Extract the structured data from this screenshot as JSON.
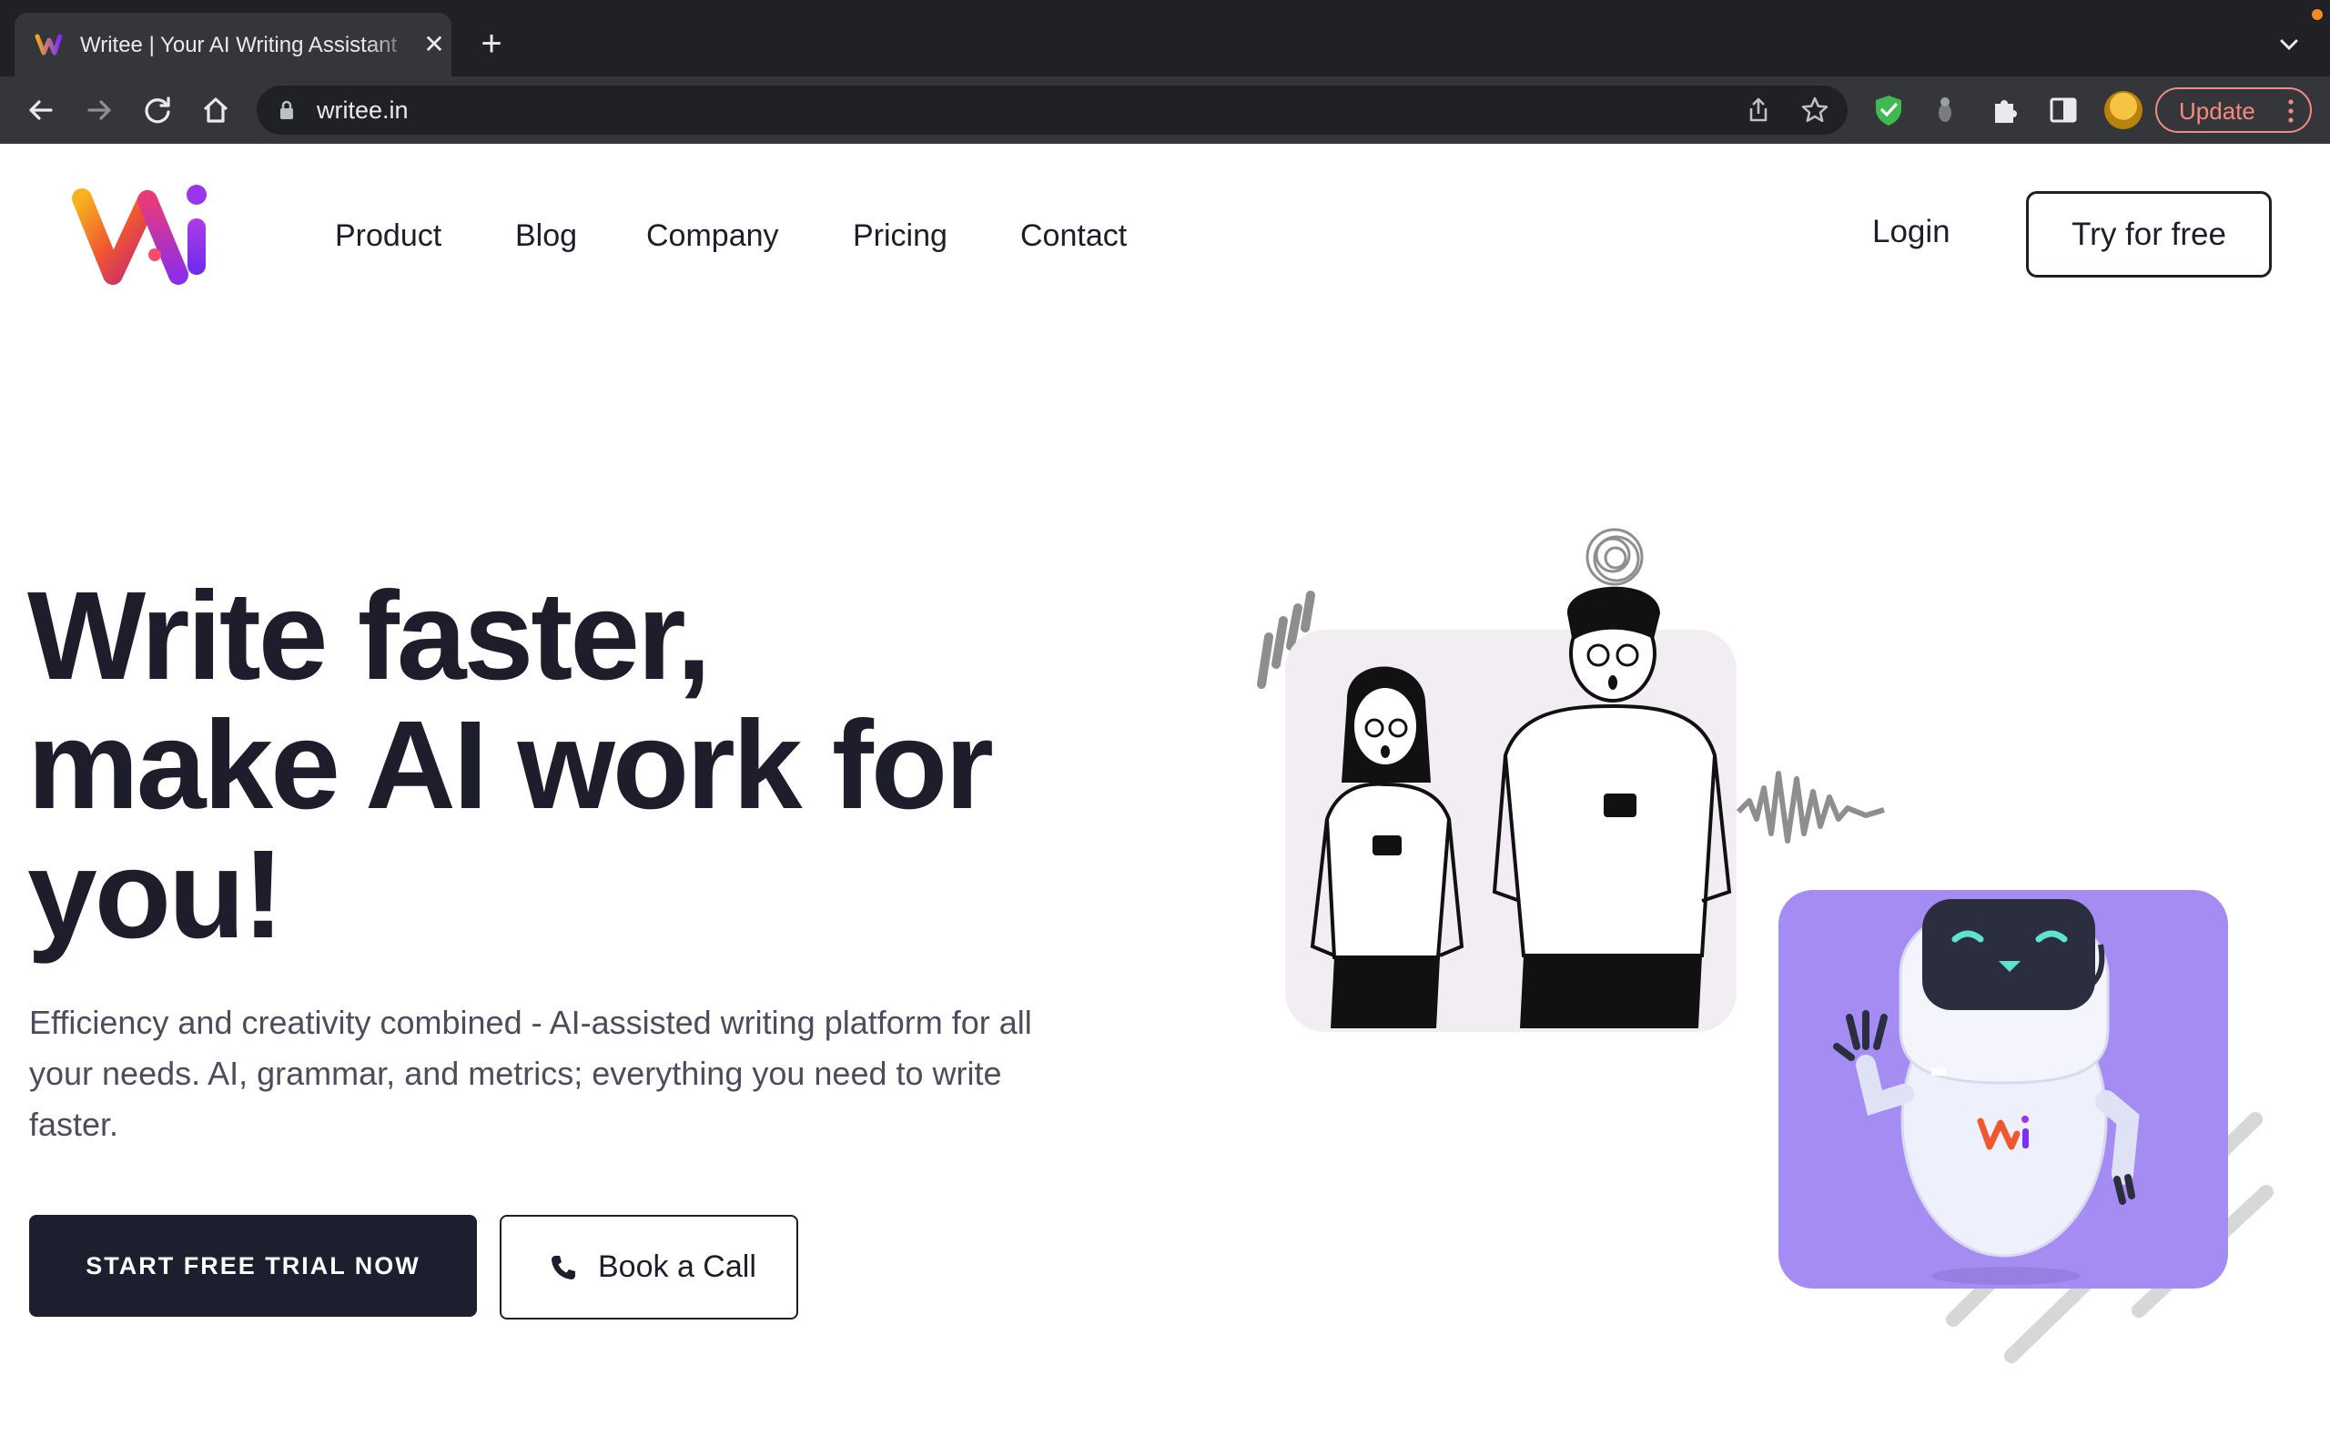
{
  "browser": {
    "tab_title": "Writee | Your AI Writing Assistant",
    "url": "writee.in",
    "update_label": "Update",
    "accent_update": "#f28b82"
  },
  "site": {
    "nav": {
      "items": [
        "Product",
        "Blog",
        "Company",
        "Pricing",
        "Contact"
      ],
      "login": "Login",
      "try_free": "Try for free"
    },
    "hero": {
      "title_lines": [
        "Write faster,",
        "make AI work for",
        "you!"
      ],
      "subtitle": "Efficiency and creativity combined - AI-assisted writing platform for all your needs. AI, grammar, and metrics; everything you need to write faster.",
      "cta_primary": "START FREE TRIAL NOW",
      "cta_secondary": "Book a Call"
    },
    "colors": {
      "text_dark": "#1d1d2b",
      "cta_bg": "#1c1f2e",
      "robot_panel": "#a58cf2",
      "people_panel": "#f2ecf3"
    }
  },
  "icons": [
    "back-icon",
    "forward-icon",
    "reload-icon",
    "home-icon",
    "lock-icon",
    "share-icon",
    "bookmark-star-icon",
    "shield-extension-icon",
    "extension-icon",
    "puzzle-icon",
    "sidepanel-icon",
    "profile-avatar",
    "phone-icon"
  ]
}
